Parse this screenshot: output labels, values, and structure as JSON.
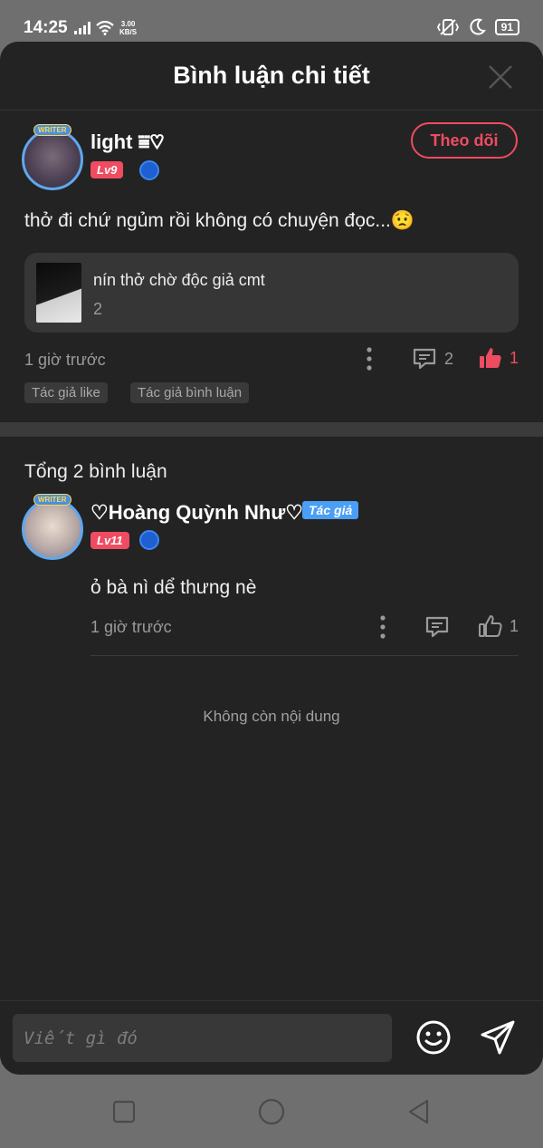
{
  "status_bar": {
    "time": "14:25",
    "net_speed_value": "3.00",
    "net_speed_unit": "KB/S",
    "battery": "91"
  },
  "sheet": {
    "title": "Bình luận chi tiết"
  },
  "main_comment": {
    "username": "light ⩸♡",
    "level": "Lv9",
    "follow_label": "Theo dõi",
    "text": "thở đi chứ ngủm rồi không có chuyện đọc...😟",
    "quoted": {
      "title": "nín thở chờ độc giả cmt",
      "count": "2"
    },
    "time": "1 giờ trước",
    "reply_count": "2",
    "like_count": "1",
    "tags": [
      "Tác giả like",
      "Tác giả bình luận"
    ]
  },
  "replies_section": {
    "total_label": "Tổng 2 bình luận"
  },
  "reply": {
    "username": "♡Hoàng Quỳnh Như♡",
    "author_badge": "Tác giả",
    "level": "Lv11",
    "text": "ỏ bà nì dể thưng nè",
    "time": "1 giờ trước",
    "like_count": "1"
  },
  "end_text": "Không còn nội dung",
  "input": {
    "placeholder": "Viết gì đó"
  },
  "avatar_badge": "WRITER",
  "colors": {
    "accent": "#ef4c62",
    "author_badge": "#4a9ef5",
    "background": "#232323"
  }
}
